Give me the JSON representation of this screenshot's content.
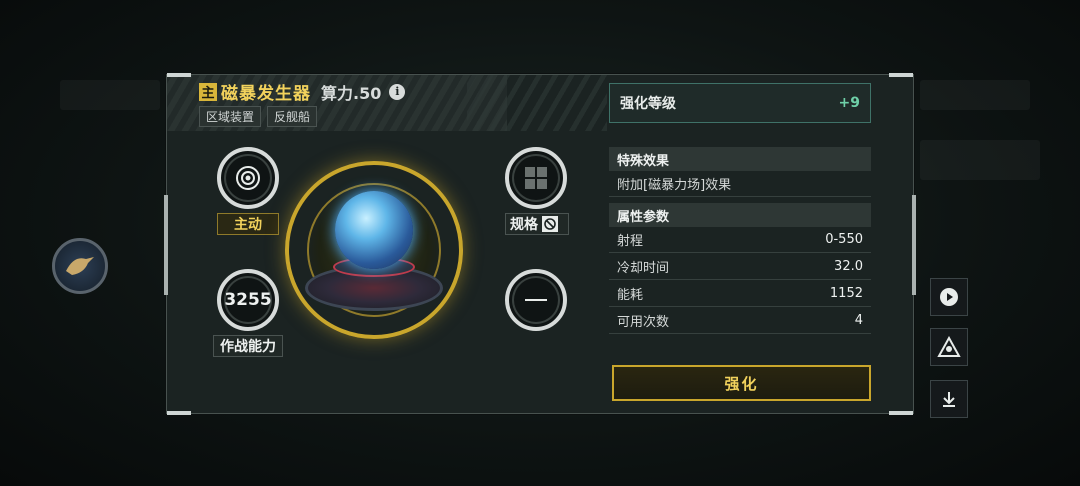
{
  "item": {
    "main_tag": "主",
    "name": "磁暴发生器",
    "power": "算力.50",
    "info_icon": "info-icon",
    "tags": [
      "区域装置",
      "反舰船"
    ]
  },
  "stats_left": {
    "mode_label": "主动",
    "combat_value": "3255",
    "combat_label": "作战能力"
  },
  "stats_right": {
    "spec_label": "规格"
  },
  "enhance": {
    "label": "强化等级",
    "value": "+9"
  },
  "special": {
    "header": "特殊效果",
    "text": "附加[磁暴力场]效果"
  },
  "attributes": {
    "header": "属性参数",
    "rows": [
      {
        "label": "射程",
        "value": "0-550"
      },
      {
        "label": "冷却时间",
        "value": "32.0"
      },
      {
        "label": "能耗",
        "value": "1152"
      },
      {
        "label": "可用次数",
        "value": "4"
      }
    ]
  },
  "button": {
    "label": "强化"
  },
  "colors": {
    "accent_gold": "#f2d25c",
    "enhance_green": "#6fd0a8",
    "panel": "#1b2322"
  }
}
